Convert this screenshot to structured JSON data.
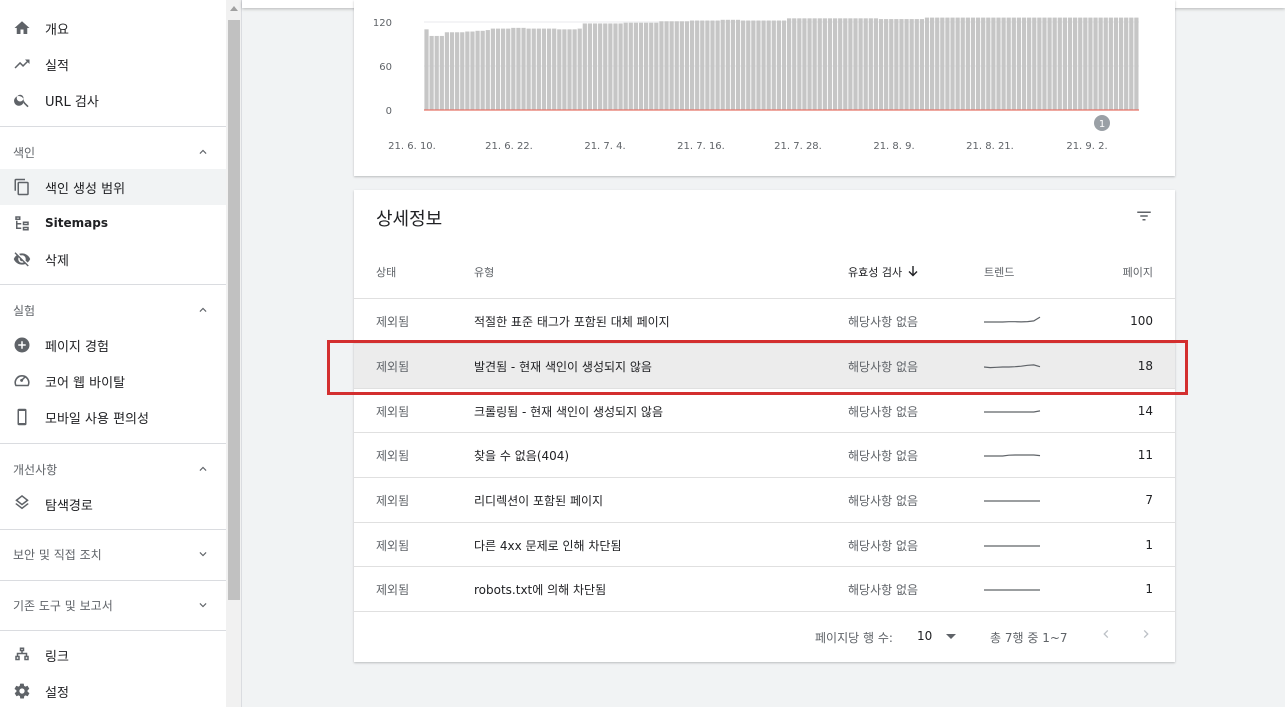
{
  "sidebar": {
    "top_items": [
      {
        "label": "개요",
        "icon": "home-icon"
      },
      {
        "label": "실적",
        "icon": "trending-up-icon"
      },
      {
        "label": "URL 검사",
        "icon": "search-icon"
      }
    ],
    "index_section": {
      "title": "색인",
      "expanded": true
    },
    "index_items": [
      {
        "label": "색인 생성 범위",
        "icon": "copy-icon",
        "active": true
      },
      {
        "label": "Sitemaps",
        "icon": "sitemap-icon"
      },
      {
        "label": "삭제",
        "icon": "eye-off-icon"
      }
    ],
    "experience_section": {
      "title": "실험",
      "expanded": true
    },
    "experience_items": [
      {
        "label": "페이지 경험",
        "icon": "plus-circle-icon"
      },
      {
        "label": "코어 웹 바이탈",
        "icon": "gauge-icon"
      },
      {
        "label": "모바일 사용 편의성",
        "icon": "phone-icon"
      }
    ],
    "enhancements_section": {
      "title": "개선사항",
      "expanded": true
    },
    "enhancements_items": [
      {
        "label": "탐색경로",
        "icon": "layers-icon"
      }
    ],
    "security_section": {
      "title": "보안 및 직접 조치",
      "expanded": false
    },
    "legacy_section": {
      "title": "기존 도구 및 보고서",
      "expanded": false
    },
    "bottom_items": [
      {
        "label": "링크",
        "icon": "links-icon"
      },
      {
        "label": "설정",
        "icon": "settings-icon"
      }
    ]
  },
  "chart_data": {
    "type": "bar",
    "yticks": [
      "120",
      "60",
      "0"
    ],
    "ylim": [
      0,
      140
    ],
    "xticks": [
      "21. 6. 10.",
      "21. 6. 22.",
      "21. 7. 4.",
      "21. 7. 16.",
      "21. 7. 28.",
      "21. 8. 9.",
      "21. 8. 21.",
      "21. 9. 2."
    ],
    "annotation": "1",
    "series": [
      {
        "values": [
          110,
          101,
          101,
          101,
          106,
          106,
          106,
          106,
          107,
          107,
          108,
          108,
          109,
          111,
          111,
          111,
          111,
          112,
          112,
          112,
          111,
          111,
          111,
          111,
          111,
          111,
          110,
          110,
          110,
          110,
          111,
          118,
          118,
          118,
          118,
          118,
          118,
          118,
          118,
          119,
          119,
          119,
          119,
          119,
          119,
          119,
          121,
          121,
          121,
          121,
          121,
          121,
          122,
          122,
          122,
          122,
          122,
          122,
          123,
          123,
          123,
          123,
          122,
          122,
          122,
          122,
          122,
          122,
          122,
          122,
          122,
          125,
          125,
          125,
          125,
          125,
          125,
          125,
          125,
          125,
          125,
          125,
          125,
          125,
          125,
          125,
          125,
          125,
          125,
          124,
          124,
          124,
          124,
          124,
          124,
          124,
          124,
          124,
          126,
          126,
          126,
          126,
          126,
          126,
          126,
          126,
          126,
          126,
          126,
          126,
          126,
          126,
          126,
          126,
          126,
          126,
          126,
          126,
          126,
          126,
          126,
          126,
          126,
          126,
          126,
          126,
          126,
          126,
          126,
          126,
          126,
          126,
          126,
          126,
          126,
          126,
          126,
          126,
          126,
          126
        ]
      },
      {
        "values": [
          0,
          0,
          0,
          0,
          0,
          0,
          0,
          0,
          0,
          0,
          0,
          0,
          0,
          0,
          0,
          0,
          0,
          0,
          0,
          0,
          0,
          0,
          0,
          0,
          0,
          0,
          0,
          0,
          0,
          0,
          0,
          0,
          0,
          0,
          0,
          0,
          0,
          0,
          0,
          0,
          0,
          0,
          0,
          0,
          0,
          0,
          0,
          0,
          0,
          0,
          0,
          0,
          0,
          0,
          0,
          0,
          0,
          0,
          0,
          0,
          0,
          0,
          0,
          0,
          0,
          0,
          0,
          0,
          0,
          0,
          0,
          0,
          0,
          0,
          0,
          0,
          0,
          0,
          0,
          0,
          0,
          0,
          0,
          0,
          0,
          0,
          0,
          0,
          0,
          0,
          0,
          0,
          0,
          0,
          0,
          0,
          0,
          0,
          0,
          0,
          0,
          0,
          0,
          0,
          0,
          0,
          0,
          0,
          0,
          0,
          0,
          0,
          0,
          0,
          0,
          0,
          0,
          0,
          0,
          0,
          0,
          0,
          0,
          0,
          0,
          0,
          0,
          0,
          0,
          0,
          0,
          0,
          0,
          0,
          0,
          0,
          0,
          0,
          0,
          0
        ]
      }
    ],
    "bar_color": "#c6c6c6",
    "line_color": "#e57368"
  },
  "details": {
    "title": "상세정보",
    "columns": {
      "status": "상태",
      "type": "유형",
      "validation": "유효성 검사",
      "trend": "트렌드",
      "pages": "페이지"
    },
    "rows": [
      {
        "status": "제외됨",
        "type": "적절한 표준 태그가 포함된 대체 페이지",
        "validation": "해당사항 없음",
        "pages": "100",
        "trend": [
          5,
          5,
          5,
          5,
          5.2,
          5.2,
          5.1,
          5.3,
          5.8,
          8.5
        ]
      },
      {
        "status": "제외됨",
        "type": "발견됨 - 현재 색인이 생성되지 않음",
        "validation": "해당사항 없음",
        "pages": "18",
        "trend": [
          5,
          4.6,
          4.8,
          5,
          5,
          5.2,
          5.6,
          6.2,
          6.5,
          5.2
        ]
      },
      {
        "status": "제외됨",
        "type": "크롤링됨 - 현재 색인이 생성되지 않음",
        "validation": "해당사항 없음",
        "pages": "14",
        "trend": [
          5,
          5,
          5,
          5,
          5,
          5,
          5,
          5,
          5,
          5.8
        ]
      },
      {
        "status": "제외됨",
        "type": "찾을 수 없음(404)",
        "validation": "해당사항 없음",
        "pages": "11",
        "trend": [
          5,
          5,
          5,
          5,
          5.6,
          5.7,
          5.7,
          5.7,
          5.7,
          5.3
        ]
      },
      {
        "status": "제외됨",
        "type": "리디렉션이 포함된 페이지",
        "validation": "해당사항 없음",
        "pages": "7",
        "trend": [
          5,
          5,
          5,
          5,
          5,
          5,
          5,
          5,
          5,
          5
        ]
      },
      {
        "status": "제외됨",
        "type": "다른 4xx 문제로 인해 차단됨",
        "validation": "해당사항 없음",
        "pages": "1",
        "trend": [
          5,
          5,
          5,
          5,
          5,
          5,
          5,
          5,
          5,
          5
        ]
      },
      {
        "status": "제외됨",
        "type": "robots.txt에 의해 차단됨",
        "validation": "해당사항 없음",
        "pages": "1",
        "trend": [
          5,
          5,
          5,
          5,
          5,
          5,
          5,
          5,
          5,
          5
        ]
      }
    ],
    "highlighted_row": 1,
    "footer": {
      "rows_per_page_label": "페이지당 행 수:",
      "rows_per_page_value": "10",
      "range_text": "총 7행 중 1~7"
    }
  }
}
